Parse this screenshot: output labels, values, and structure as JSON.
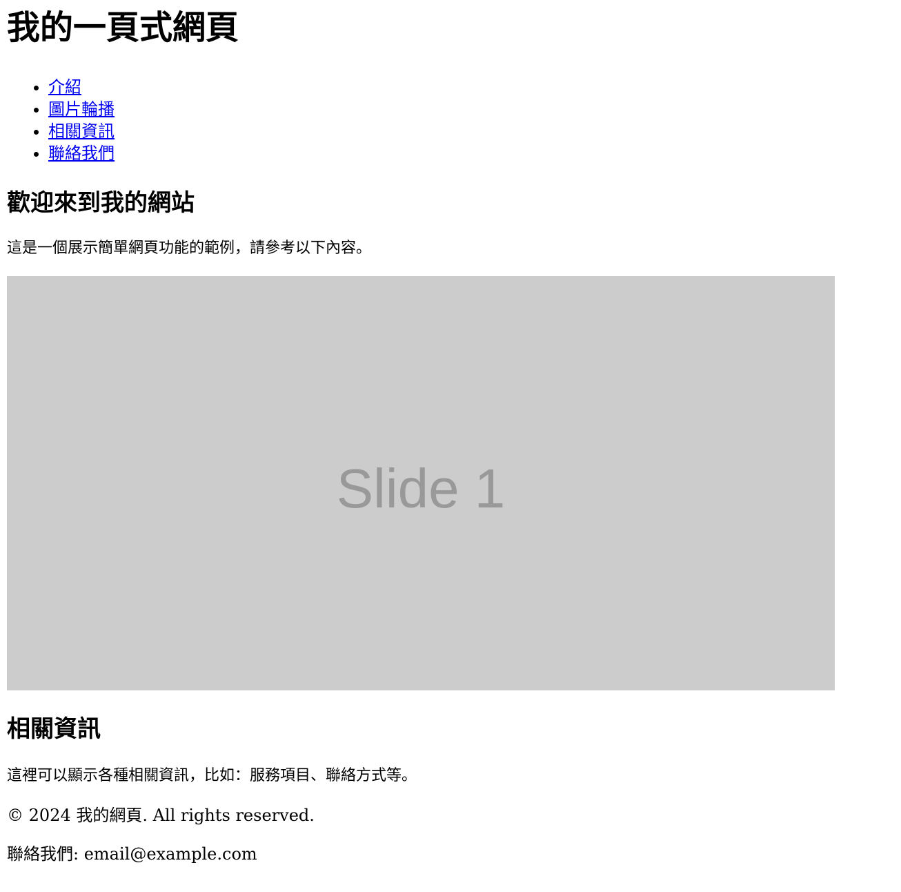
{
  "header": {
    "title": "我的一頁式網頁"
  },
  "nav": {
    "items": [
      {
        "label": "介紹"
      },
      {
        "label": "圖片輪播"
      },
      {
        "label": "相關資訊"
      },
      {
        "label": "聯絡我們"
      }
    ]
  },
  "intro": {
    "title": "歡迎來到我的網站",
    "text": "這是一個展示簡單網頁功能的範例，請參考以下內容。"
  },
  "slider": {
    "current_slide_label": "Slide 1",
    "background_color": "#cccccc",
    "label_color": "#999999"
  },
  "info": {
    "title": "相關資訊",
    "text": "這裡可以顯示各種相關資訊，比如：服務項目、聯絡方式等。"
  },
  "footer": {
    "copyright": "© 2024 我的網頁. All rights reserved.",
    "contact": "聯絡我們: email@example.com"
  },
  "colors": {
    "link": "#0000ee",
    "text": "#000000",
    "background": "#ffffff"
  }
}
